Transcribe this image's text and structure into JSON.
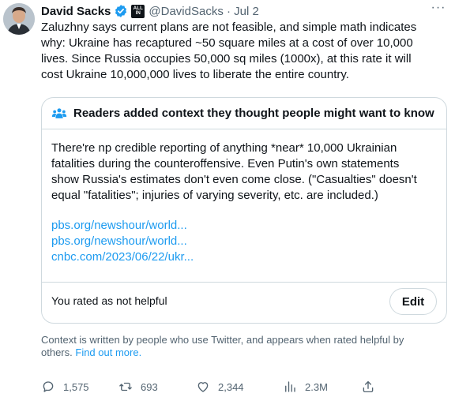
{
  "author": {
    "name": "David Sacks",
    "handle": "@DavidSacks",
    "date": "Jul 2",
    "badge_text": "ALL IN"
  },
  "tweet": {
    "text": "Zaluzhny says current plans are not feasible, and simple math indicates\nwhy: Ukraine has recaptured ~50 square miles at a cost of over 10,000\nlives. Since Russia occupies 50,000 sq miles (1000x), at this rate it will\ncost Ukraine 10,000,000 lives to liberate the entire country."
  },
  "note": {
    "header": "Readers added context they thought people might want to know",
    "body": "There're np credible reporting of anything *near* 10,000 Ukrainian\nfatalities during the counteroffensive. Even Putin's own statements\nshow Russia's estimates don't even come close. (\"Casualties\" doesn't\nequal \"fatalities\"; injuries of varying severity, etc. are included.)",
    "links": [
      "pbs.org/newshour/world...",
      "pbs.org/newshour/world...",
      "cnbc.com/2023/06/22/ukr..."
    ],
    "rating": "You rated as not helpful",
    "edit_label": "Edit"
  },
  "context_note": {
    "text": "Context is written by people who use Twitter, and appears when rated helpful by others.",
    "link": "Find out more."
  },
  "actions": {
    "replies": "1,575",
    "retweets": "693",
    "likes": "2,344",
    "views": "2.3M"
  },
  "colors": {
    "link": "#1d9bf0",
    "secondary_text": "#536471",
    "border": "#cfd9de",
    "verified": "#1d9bf0"
  },
  "icons": [
    "verified-icon",
    "more-icon",
    "readers-icon",
    "reply-icon",
    "retweet-icon",
    "like-icon",
    "views-icon",
    "share-icon"
  ]
}
